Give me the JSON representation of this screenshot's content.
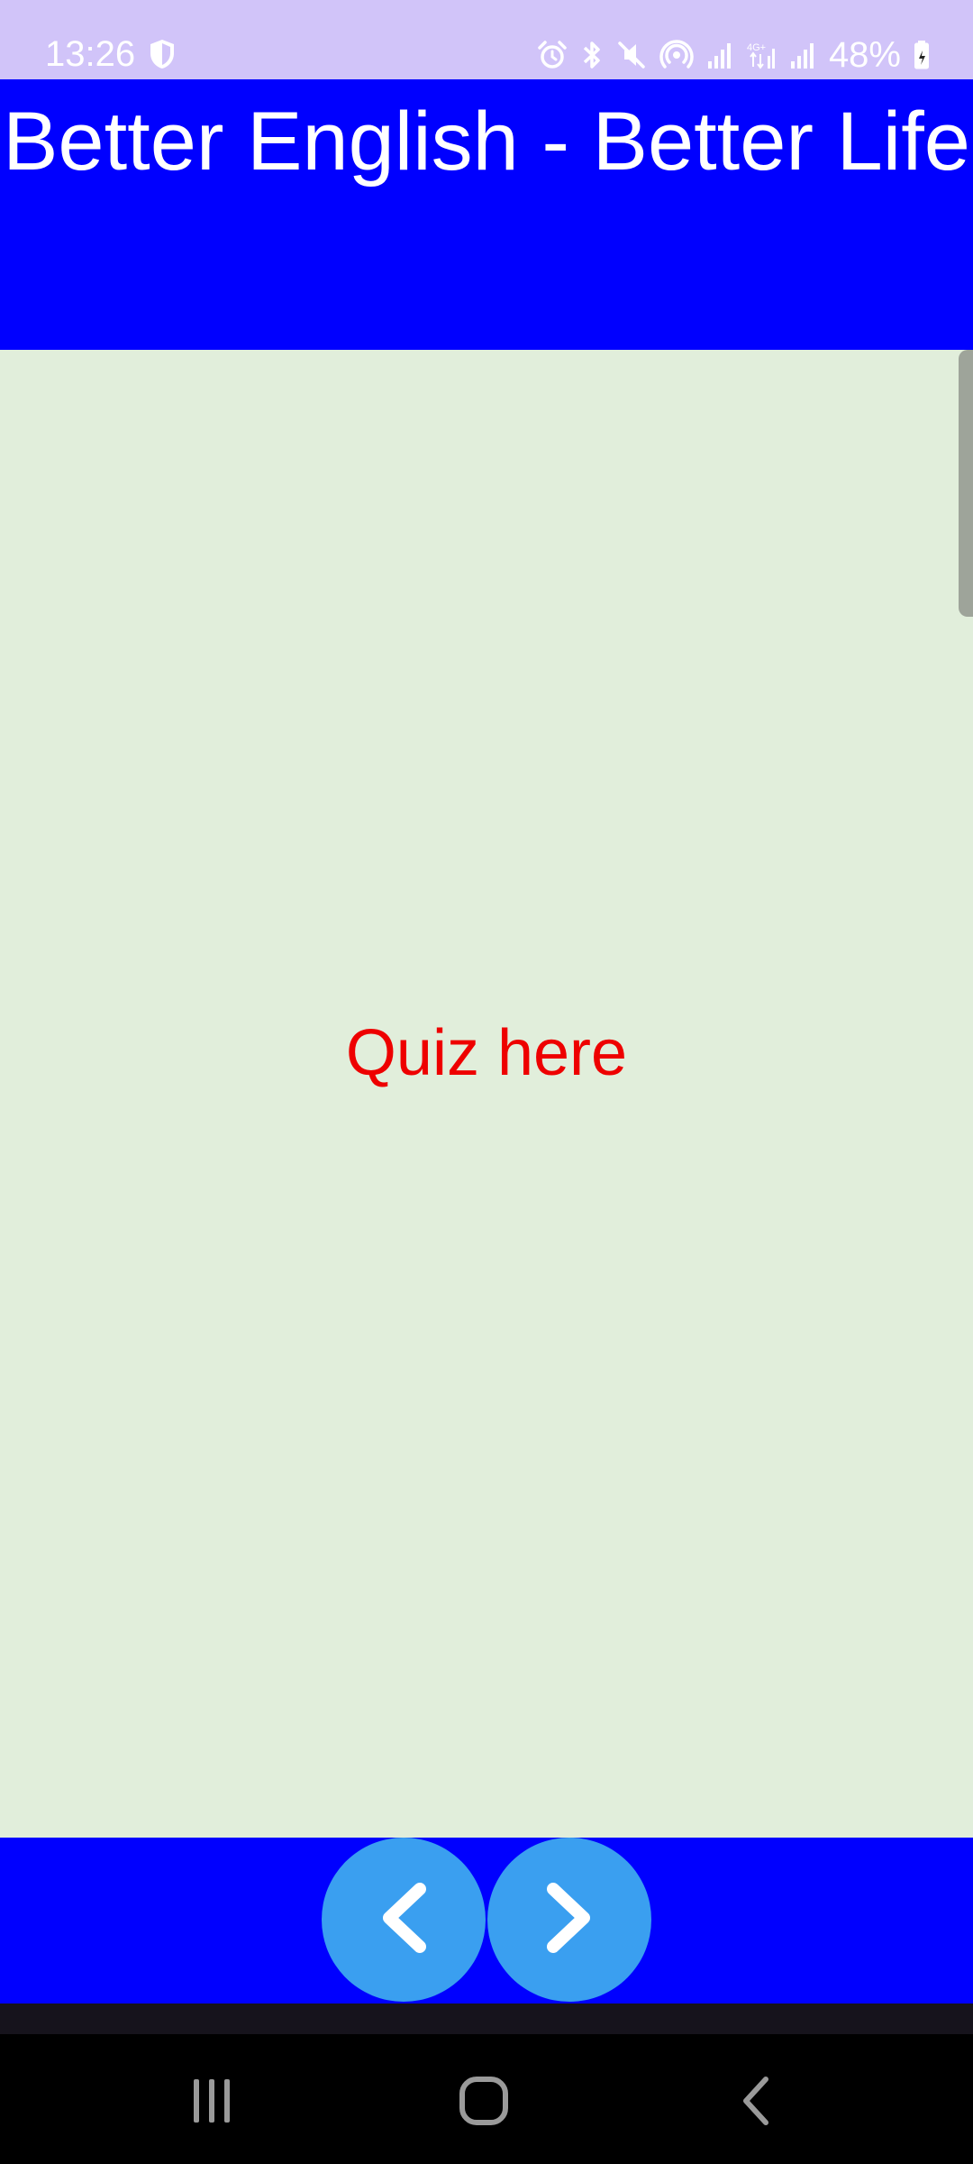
{
  "status_bar": {
    "time": "13:26",
    "battery": "48%",
    "left_icons": [
      "shield-icon"
    ],
    "right_icons": [
      "alarm-icon",
      "bluetooth-icon",
      "mute-icon",
      "hotspot-icon",
      "signal-icon",
      "4g-signal-icon",
      "signal-icon-2",
      "battery-icon"
    ],
    "background": "#d1c4f9"
  },
  "header": {
    "title": "Better English - Better Life",
    "background": "#0000ff"
  },
  "content": {
    "placeholder": "Quiz here",
    "placeholder_color": "#ee0000",
    "background": "#e1eedb"
  },
  "bottom_bar": {
    "background": "#0000ff",
    "button_color": "#3a9ff0",
    "buttons": [
      {
        "name": "previous",
        "icon": "chevron-left-icon"
      },
      {
        "name": "next",
        "icon": "chevron-right-icon"
      }
    ]
  },
  "system_nav": {
    "buttons": [
      {
        "name": "recents",
        "icon": "recents-icon"
      },
      {
        "name": "home",
        "icon": "home-icon"
      },
      {
        "name": "back",
        "icon": "back-icon"
      }
    ]
  }
}
